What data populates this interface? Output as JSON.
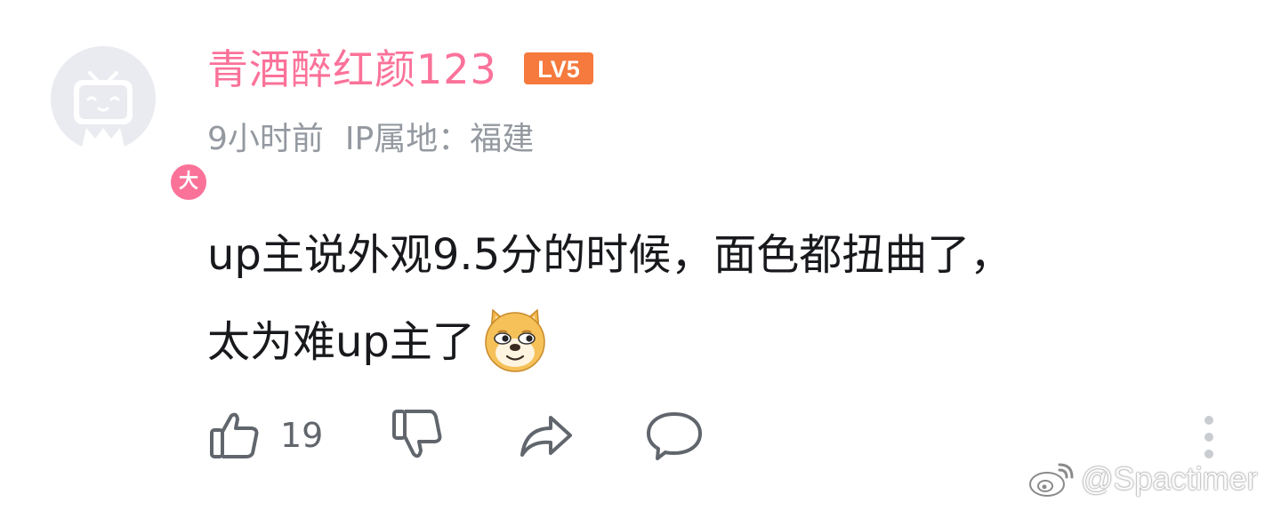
{
  "user": {
    "name": "青酒醉红颜123",
    "level": "LV5",
    "vip_badge": "大"
  },
  "meta": {
    "time": "9小时前",
    "ip_location": "IP属地：福建"
  },
  "comment": {
    "line1": "up主说外观9.5分的时候，面色都扭曲了，",
    "line2": "太为难up主了",
    "emoji": "doge-emoji"
  },
  "actions": {
    "like_count": "19"
  },
  "watermark": {
    "text": "@Spactimer"
  },
  "colors": {
    "username": "#fb7299",
    "meta": "#9499a0",
    "body": "#18191c",
    "icon": "#61666d",
    "level_badge": "#f6793d"
  }
}
